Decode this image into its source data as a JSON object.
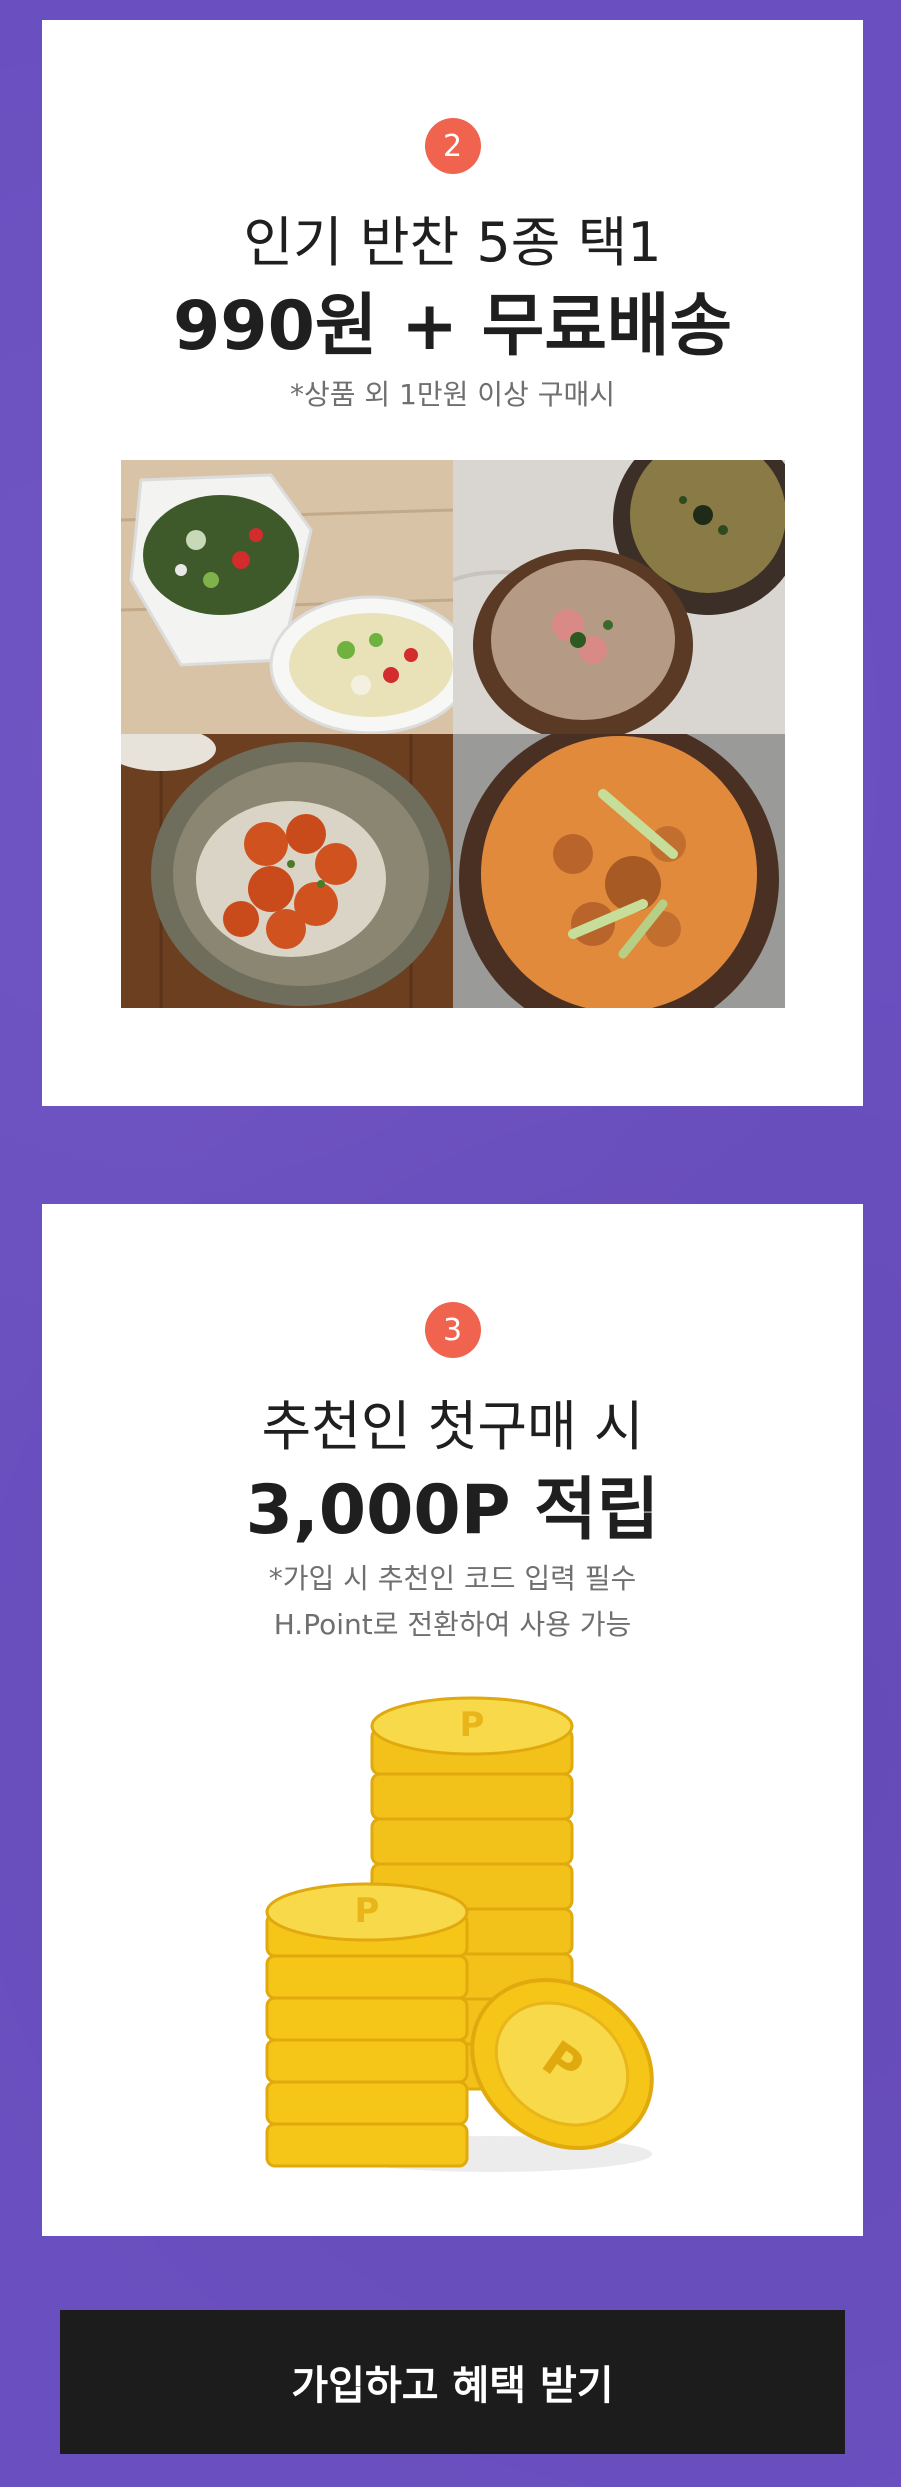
{
  "benefit2": {
    "number": "2",
    "line1": "인기 반찬 5종 택1",
    "line2": "990원 + 무료배송",
    "note": "*상품 외 1만원 이상 구매시"
  },
  "benefit3": {
    "number": "3",
    "line1": "추천인 첫구매 시",
    "line2": "3,000P 적립",
    "note1": "*가입 시 추천인 코드 입력 필수",
    "note2": "H.Point로 전환하여 사용 가능"
  },
  "cta": {
    "label": "가입하고 혜택 받기"
  },
  "colors": {
    "background": "#6a4fc0",
    "badge": "#f0644f",
    "button": "#1c1c1c",
    "coin": "#f5c518"
  },
  "images": {
    "food": [
      "seaweed-soup-and-bean-sprout-soup",
      "fried-rice-bowls",
      "chili-shrimp-on-rice",
      "pork-stew-pot"
    ],
    "coins": "gold-point-coins"
  }
}
